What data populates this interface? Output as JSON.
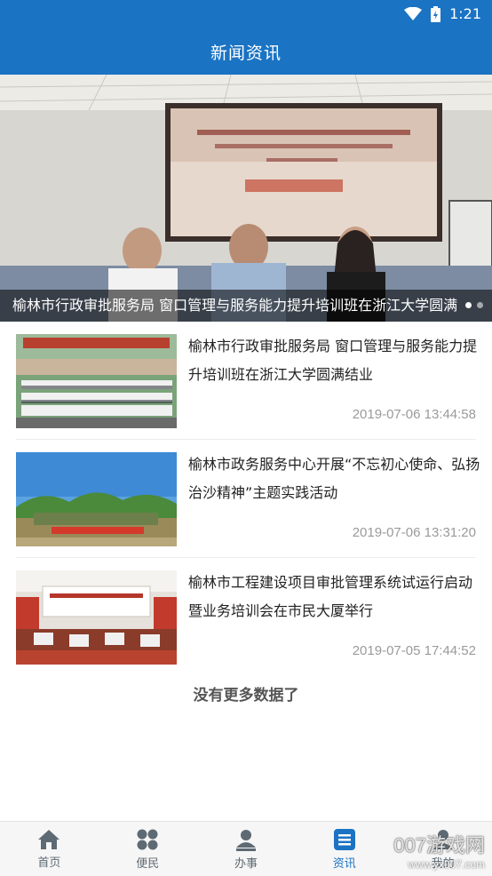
{
  "status_bar": {
    "time": "1:21",
    "icons": [
      "wifi-icon",
      "battery-charging-icon"
    ]
  },
  "header": {
    "title": "新闻资讯"
  },
  "banner": {
    "caption": "榆林市行政审批服务局 窗口管理与服务能力提升培训班在浙江大学圆满",
    "slide_count": 2,
    "active_slide": 1
  },
  "news": [
    {
      "title": "榆林市行政审批服务局 窗口管理与服务能力提升培训班在浙江大学圆满结业",
      "date": "2019-07-06 13:44:58"
    },
    {
      "title": "榆林市政务服务中心开展“不忘初心使命、弘扬治沙精神”主题实践活动",
      "date": "2019-07-06 13:31:20"
    },
    {
      "title": "榆林市工程建设项目审批管理系统试运行启动暨业务培训会在市民大厦举行",
      "date": "2019-07-05 17:44:52"
    }
  ],
  "footer_note": "没有更多数据了",
  "tabs": [
    {
      "label": "首页",
      "icon": "home-icon",
      "active": false
    },
    {
      "label": "便民",
      "icon": "grid-icon",
      "active": false
    },
    {
      "label": "办事",
      "icon": "user-icon",
      "active": false
    },
    {
      "label": "资讯",
      "icon": "news-icon",
      "active": true
    },
    {
      "label": "我的",
      "icon": "profile-icon",
      "active": false
    }
  ],
  "watermark": {
    "main": "007游戏网",
    "sub": "www.yx007.com"
  },
  "colors": {
    "primary": "#1a73c3",
    "tab_inactive": "#5e6a73",
    "date": "#9a9a9a"
  }
}
